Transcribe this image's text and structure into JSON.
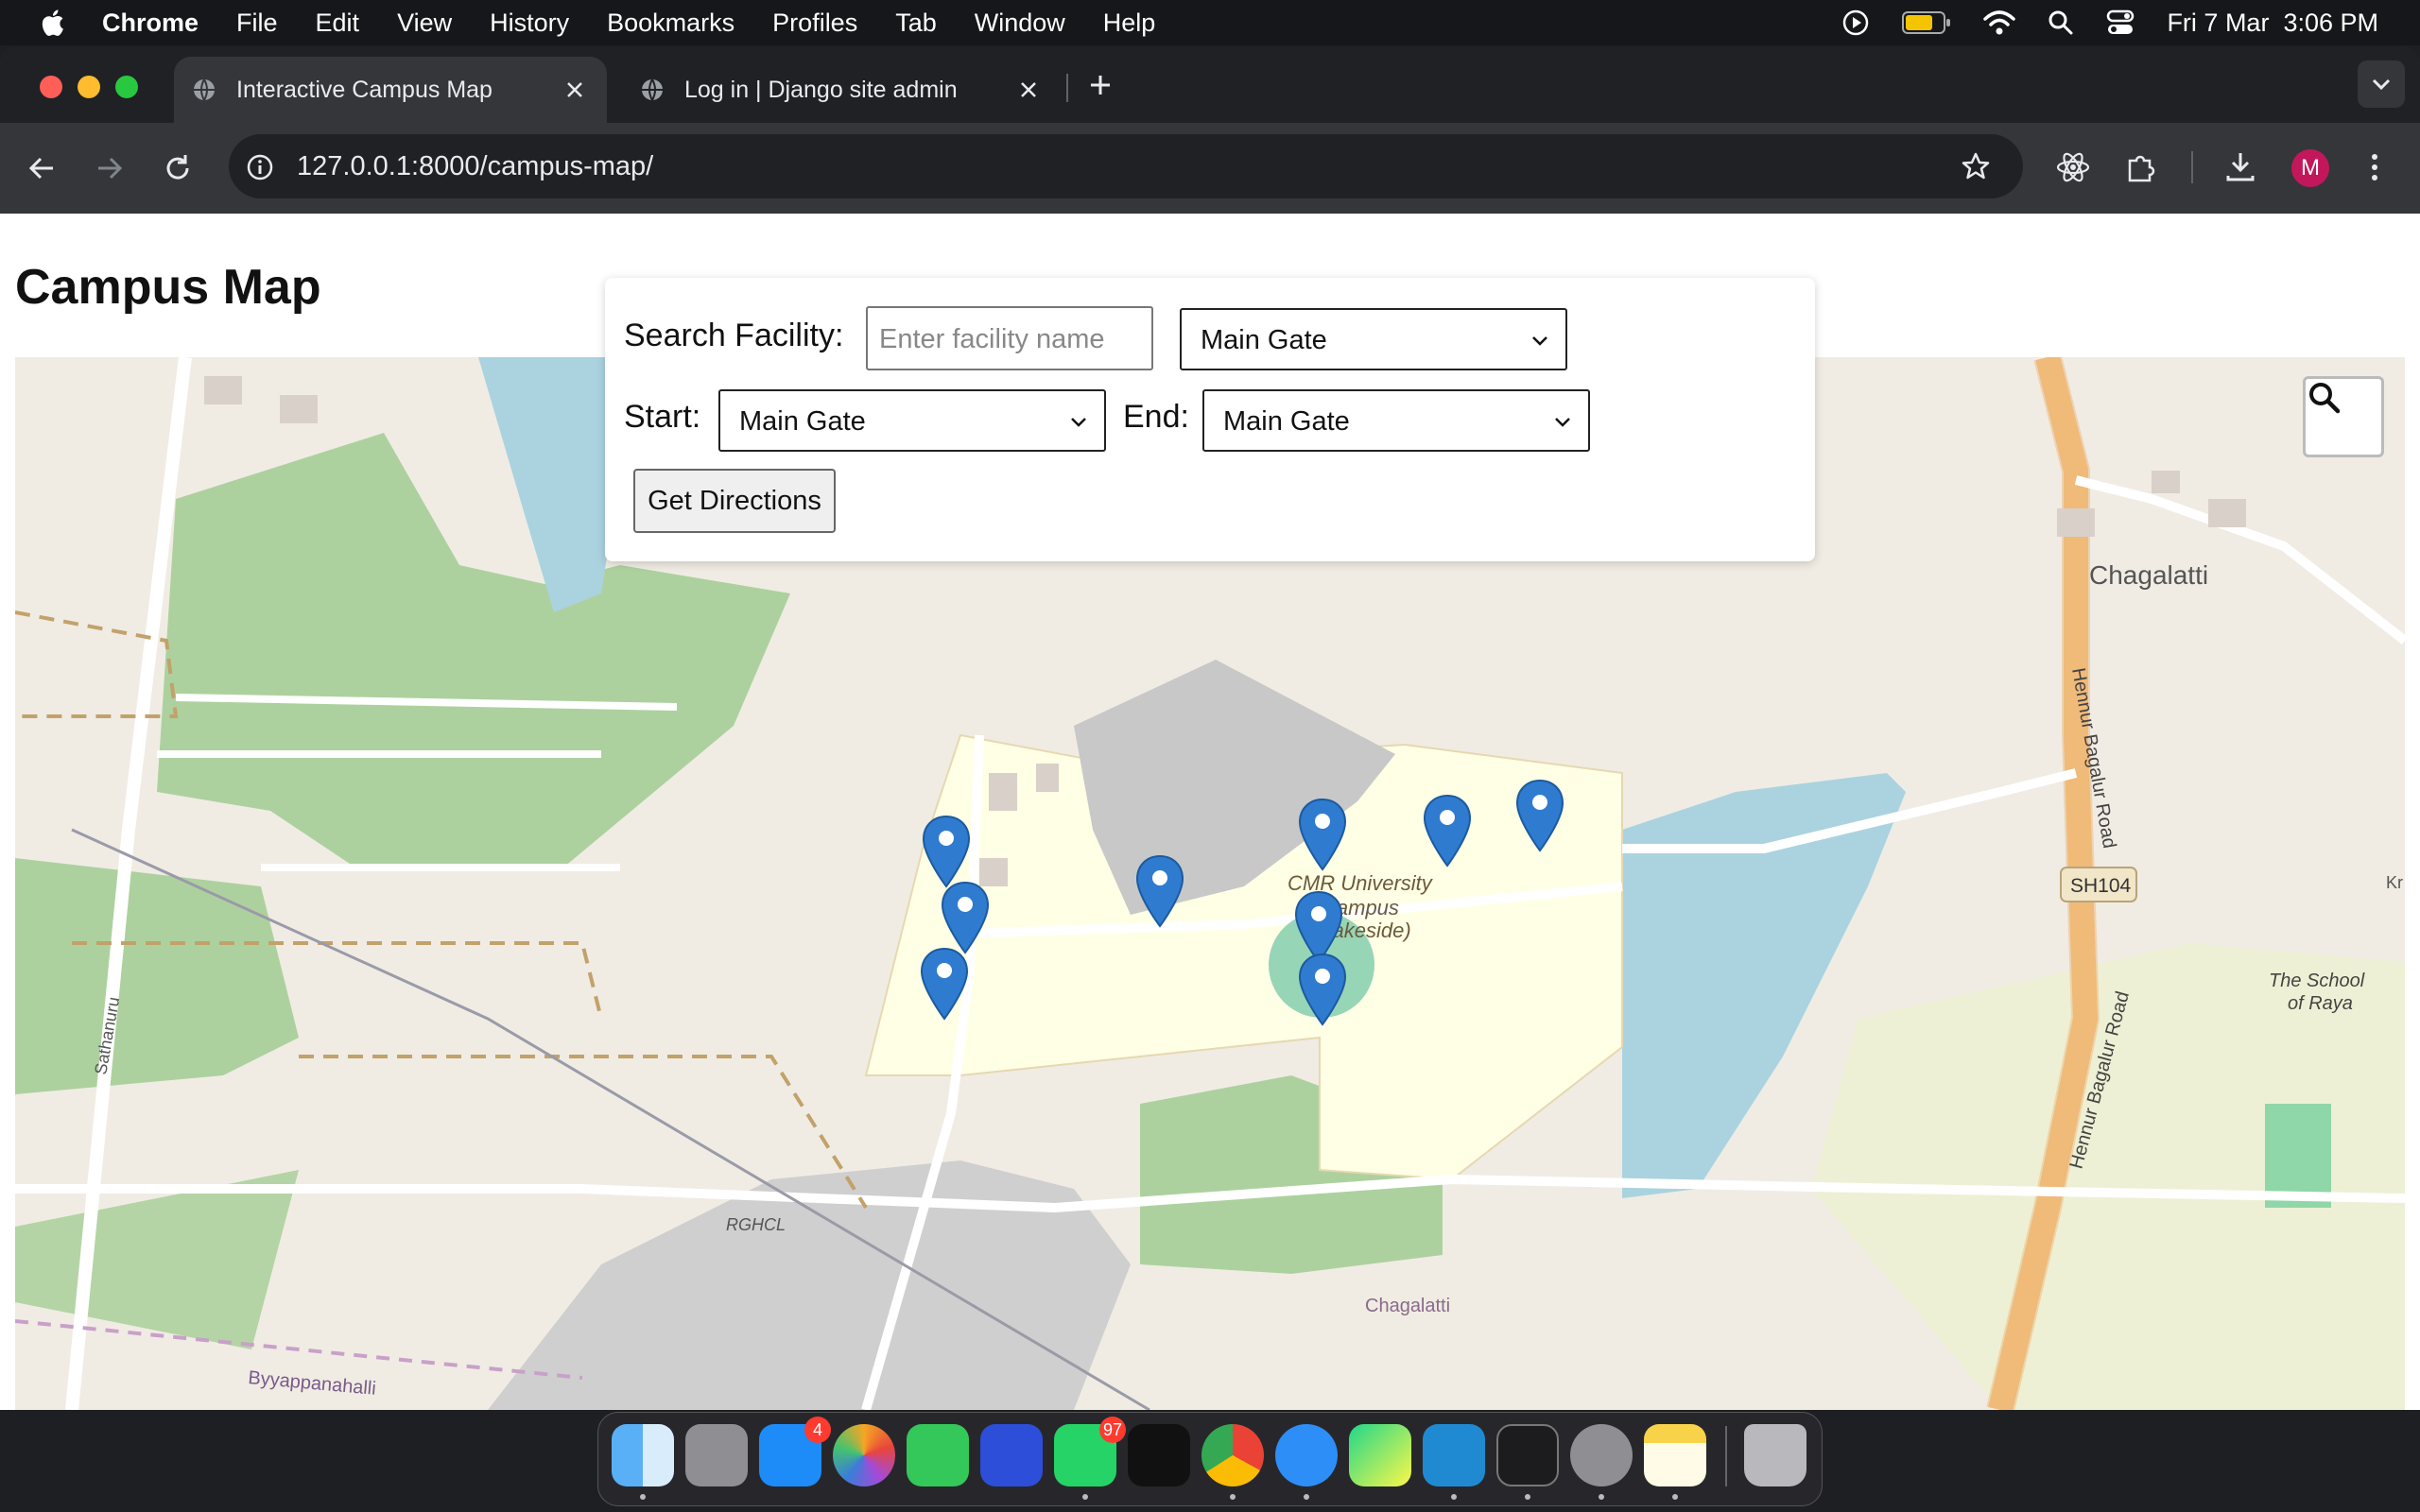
{
  "menubar": {
    "app_name": "Chrome",
    "menus": [
      "File",
      "Edit",
      "View",
      "History",
      "Bookmarks",
      "Profiles",
      "Tab",
      "Window",
      "Help"
    ],
    "datetime": "Fri 7 Mar  3:06 PM"
  },
  "browser": {
    "tabs": [
      {
        "title": "Interactive Campus Map",
        "active": true
      },
      {
        "title": "Log in | Django site admin",
        "active": false
      }
    ],
    "url": "127.0.0.1:8000/campus-map/",
    "profile_initial": "M",
    "profile_color": "#c2185b"
  },
  "page": {
    "title": "Campus Map",
    "search": {
      "label": "Search Facility:",
      "placeholder": "Enter facility name",
      "select_value": "Main Gate"
    },
    "route": {
      "start_label": "Start:",
      "start_value": "Main Gate",
      "end_label": "End:",
      "end_value": "Main Gate"
    },
    "directions_button": "Get Directions"
  },
  "map": {
    "labels": {
      "chagalatti": "Chagalatti",
      "campus_line1": "CMR University",
      "campus_line2": "Campus",
      "campus_line3": "(Lakeside)",
      "road_name": "Hennur Bagalur Road",
      "road_name2": "Hennur Bagalur Road",
      "route_shield": "SH104",
      "school_line1": "The School",
      "school_line2": "of Raya",
      "chagalatti_road": "Chagalatti",
      "rghcl": "RGHCL",
      "byyappanahalli": "Byyappanahalli",
      "sathanuru": "Sathanuru",
      "edge_label": "Kr"
    },
    "marker_color": "#2f7bd0",
    "marker_count": 9
  },
  "dock": {
    "apps": [
      "Finder",
      "Launchpad",
      "App Store",
      "Photos",
      "FaceTime",
      "Screen Sharing",
      "WhatsApp",
      "Apple TV",
      "Chrome",
      "Safari",
      "PyCharm",
      "VS Code",
      "Terminal",
      "System Settings",
      "Notes",
      "Trash"
    ],
    "badges": {
      "app_store": "4",
      "whatsapp": "97"
    }
  }
}
